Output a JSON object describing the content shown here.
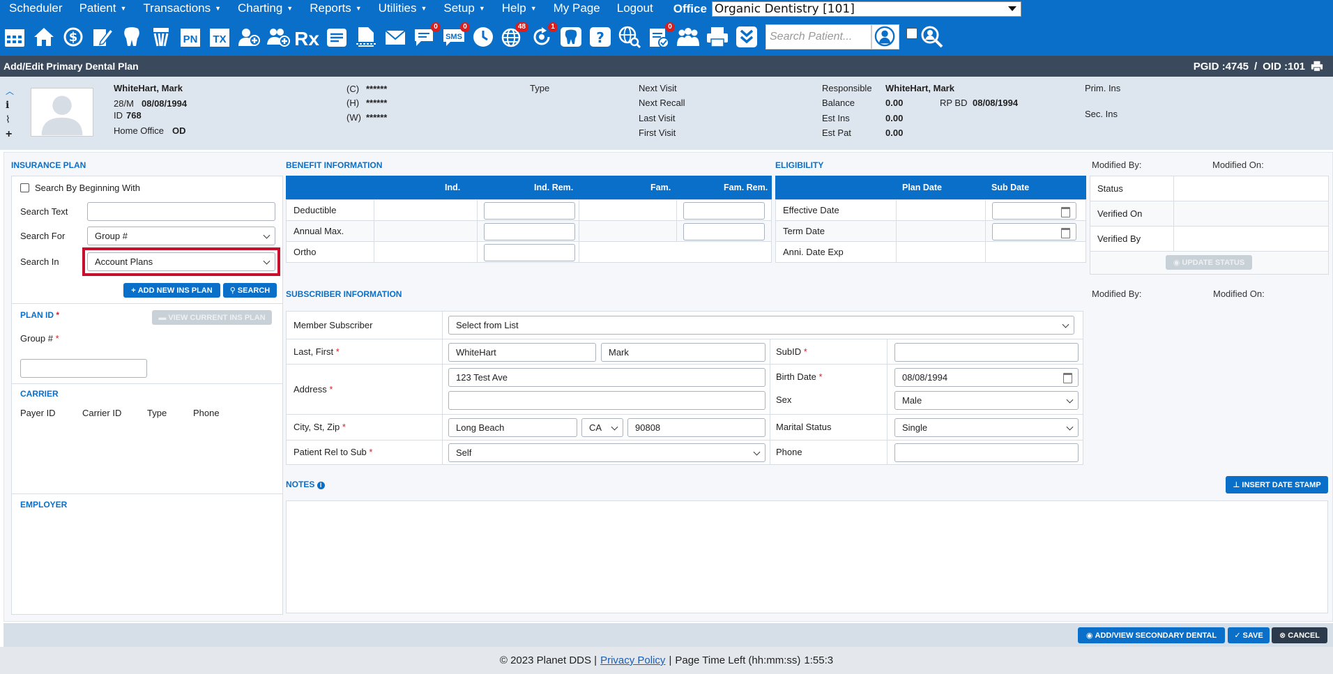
{
  "menu": {
    "items": [
      {
        "label": "Scheduler",
        "caret": false
      },
      {
        "label": "Patient",
        "caret": true
      },
      {
        "label": "Transactions",
        "caret": true
      },
      {
        "label": "Charting",
        "caret": true
      },
      {
        "label": "Reports",
        "caret": true
      },
      {
        "label": "Utilities",
        "caret": true
      },
      {
        "label": "Setup",
        "caret": true
      },
      {
        "label": "Help",
        "caret": true
      },
      {
        "label": "My Page",
        "caret": false
      },
      {
        "label": "Logout",
        "caret": false
      }
    ],
    "office_label": "Office",
    "office_value": "Organic Dentistry [101]"
  },
  "toolbar": {
    "badges": {
      "messages": "0",
      "sms": "0",
      "globe": "48",
      "recall": "1",
      "clipboard": "0"
    },
    "sms_text": "SMS",
    "pn_text": "PN",
    "tx_text": "TX",
    "rx_text": "Rx",
    "search_placeholder": "Search Patient..."
  },
  "title": {
    "text": "Add/Edit Primary Dental Plan",
    "pgid": "PGID :4745",
    "sep": "/",
    "oid": "OID :101"
  },
  "patient": {
    "name": "WhiteHart, Mark",
    "age_sex": "28/M",
    "dob": "08/08/1994",
    "id_label": "ID",
    "id": "768",
    "home_office_label": "Home Office",
    "home_office": "OD",
    "phones": [
      {
        "label": "(C)",
        "value": "******"
      },
      {
        "label": "(H)",
        "value": "******"
      },
      {
        "label": "(W)",
        "value": "******"
      }
    ],
    "type_label": "Type",
    "visits": [
      "Next Visit",
      "Next Recall",
      "Last Visit",
      "First Visit"
    ],
    "responsible_label": "Responsible",
    "responsible": "WhiteHart, Mark",
    "balance_label": "Balance",
    "balance": "0.00",
    "rpbd_label": "RP BD",
    "rpbd": "08/08/1994",
    "est_ins_label": "Est Ins",
    "est_ins": "0.00",
    "est_pat_label": "Est Pat",
    "est_pat": "0.00",
    "prim_ins_label": "Prim. Ins",
    "sec_ins_label": "Sec. Ins"
  },
  "insurance_plan": {
    "heading": "Insurance Plan",
    "search_beginning_label": "Search By Beginning With",
    "search_text_label": "Search Text",
    "search_text_value": "",
    "search_for_label": "Search For",
    "search_for_value": "Group #",
    "search_in_label": "Search In",
    "search_in_value": "Account Plans",
    "add_new_label": "Add New Ins Plan",
    "search_label": "Search",
    "plan_id_label": "Plan ID",
    "view_current_label": "View Current Ins Plan",
    "group_label": "Group #",
    "group_value": ""
  },
  "carrier": {
    "heading": "Carrier",
    "cols": [
      "Payer ID",
      "Carrier ID",
      "Type",
      "Phone"
    ]
  },
  "employer": {
    "heading": "Employer"
  },
  "benefit": {
    "heading": "Benefit Information",
    "cols": [
      "Ind.",
      "Ind. Rem.",
      "Fam.",
      "Fam. Rem."
    ],
    "rows": [
      "Deductible",
      "Annual Max.",
      "Ortho"
    ]
  },
  "eligibility": {
    "heading": "Eligibility",
    "cols": [
      "Plan Date",
      "Sub Date"
    ],
    "rows": [
      "Effective Date",
      "Term Date",
      "Anni. Date Exp"
    ]
  },
  "status": {
    "modified_by": "Modified By:",
    "modified_on": "Modified On:",
    "rows": [
      "Status",
      "Verified On",
      "Verified By"
    ],
    "update_label": "Update Status"
  },
  "subscriber": {
    "heading": "Subscriber Information",
    "member_label": "Member Subscriber",
    "member_value": "Select from List",
    "last_first_label": "Last, First",
    "last": "WhiteHart",
    "first": "Mark",
    "subid_label": "SubID",
    "subid_value": "",
    "address_label": "Address",
    "address1": "123 Test Ave",
    "address2": "",
    "birth_label": "Birth Date",
    "birth_value": "08/08/1994",
    "sex_label": "Sex",
    "sex_value": "Male",
    "city_label": "City, St, Zip",
    "city": "Long Beach",
    "state": "CA",
    "zip": "90808",
    "marital_label": "Marital Status",
    "marital_value": "Single",
    "rel_label": "Patient Rel to Sub",
    "rel_value": "Self",
    "phone_label": "Phone",
    "phone_value": "",
    "modified_by": "Modified By:",
    "modified_on": "Modified On:"
  },
  "notes": {
    "heading": "Notes",
    "insert_label": "Insert Date Stamp",
    "value": ""
  },
  "actions": {
    "secondary_label": "Add/View Secondary Dental",
    "save_label": "Save",
    "cancel_label": "Cancel"
  },
  "footer": {
    "copyright": "© 2023 Planet DDS |",
    "privacy": "Privacy Policy",
    "sep": "|",
    "time_label": "Page Time Left (hh:mm:ss)",
    "time_value": "1:55:3"
  },
  "colors": {
    "primary": "#0a6fc9",
    "title_bar": "#3a4a5c",
    "highlight": "#c8102e",
    "required": "#d81e1e"
  }
}
